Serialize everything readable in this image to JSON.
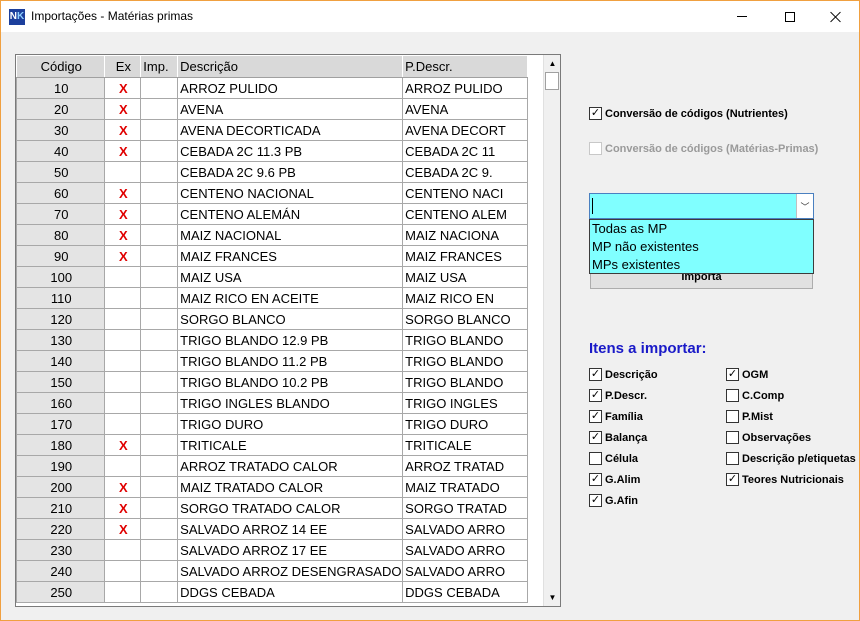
{
  "window": {
    "title": "Importações - Matérias primas",
    "icon_label": "NK"
  },
  "grid": {
    "headers": [
      "Código",
      "Ex",
      "Imp.",
      "Descrição",
      "P.Descr."
    ],
    "rows": [
      {
        "code": "10",
        "ex": "X",
        "imp": "",
        "desc": "ARROZ PULIDO",
        "pdesc": "ARROZ PULIDO"
      },
      {
        "code": "20",
        "ex": "X",
        "imp": "",
        "desc": "AVENA",
        "pdesc": "AVENA"
      },
      {
        "code": "30",
        "ex": "X",
        "imp": "",
        "desc": "AVENA DECORTICADA",
        "pdesc": "AVENA DECORT"
      },
      {
        "code": "40",
        "ex": "X",
        "imp": "",
        "desc": "CEBADA 2C 11.3 PB",
        "pdesc": "CEBADA 2C 11"
      },
      {
        "code": "50",
        "ex": "",
        "imp": "",
        "desc": "CEBADA 2C 9.6 PB",
        "pdesc": "CEBADA 2C 9."
      },
      {
        "code": "60",
        "ex": "X",
        "imp": "",
        "desc": "CENTENO NACIONAL",
        "pdesc": "CENTENO NACI"
      },
      {
        "code": "70",
        "ex": "X",
        "imp": "",
        "desc": "CENTENO ALEMÁN",
        "pdesc": "CENTENO ALEM"
      },
      {
        "code": "80",
        "ex": "X",
        "imp": "",
        "desc": "MAIZ NACIONAL",
        "pdesc": "MAIZ NACIONA"
      },
      {
        "code": "90",
        "ex": "X",
        "imp": "",
        "desc": "MAIZ FRANCES",
        "pdesc": "MAIZ FRANCES"
      },
      {
        "code": "100",
        "ex": "",
        "imp": "",
        "desc": "MAIZ USA",
        "pdesc": "MAIZ USA"
      },
      {
        "code": "110",
        "ex": "",
        "imp": "",
        "desc": "MAIZ RICO EN ACEITE",
        "pdesc": "MAIZ RICO EN"
      },
      {
        "code": "120",
        "ex": "",
        "imp": "",
        "desc": "SORGO BLANCO",
        "pdesc": "SORGO BLANCO"
      },
      {
        "code": "130",
        "ex": "",
        "imp": "",
        "desc": "TRIGO BLANDO 12.9 PB",
        "pdesc": "TRIGO BLANDO"
      },
      {
        "code": "140",
        "ex": "",
        "imp": "",
        "desc": "TRIGO BLANDO 11.2 PB",
        "pdesc": "TRIGO BLANDO"
      },
      {
        "code": "150",
        "ex": "",
        "imp": "",
        "desc": "TRIGO BLANDO 10.2 PB",
        "pdesc": "TRIGO BLANDO"
      },
      {
        "code": "160",
        "ex": "",
        "imp": "",
        "desc": "TRIGO INGLES BLANDO",
        "pdesc": "TRIGO INGLES"
      },
      {
        "code": "170",
        "ex": "",
        "imp": "",
        "desc": "TRIGO DURO",
        "pdesc": "TRIGO DURO"
      },
      {
        "code": "180",
        "ex": "X",
        "imp": "",
        "desc": "TRITICALE",
        "pdesc": "TRITICALE"
      },
      {
        "code": "190",
        "ex": "",
        "imp": "",
        "desc": "ARROZ TRATADO CALOR",
        "pdesc": "ARROZ TRATAD"
      },
      {
        "code": "200",
        "ex": "X",
        "imp": "",
        "desc": "MAIZ TRATADO CALOR",
        "pdesc": "MAIZ TRATADO"
      },
      {
        "code": "210",
        "ex": "X",
        "imp": "",
        "desc": "SORGO TRATADO CALOR",
        "pdesc": "SORGO TRATAD"
      },
      {
        "code": "220",
        "ex": "X",
        "imp": "",
        "desc": "SALVADO ARROZ 14 EE",
        "pdesc": "SALVADO ARRO"
      },
      {
        "code": "230",
        "ex": "",
        "imp": "",
        "desc": "SALVADO ARROZ 17 EE",
        "pdesc": "SALVADO ARRO"
      },
      {
        "code": "240",
        "ex": "",
        "imp": "",
        "desc": "SALVADO ARROZ DESENGRASADO",
        "pdesc": "SALVADO ARRO"
      },
      {
        "code": "250",
        "ex": "",
        "imp": "",
        "desc": "DDGS CEBADA",
        "pdesc": "DDGS CEBADA"
      }
    ]
  },
  "options": {
    "conv_nutrientes": {
      "label": "Conversão de códigos (Nutrientes)",
      "checked": true
    },
    "conv_mp": {
      "label": "Conversão de códigos (Matérias-Primas)",
      "checked": false,
      "disabled": true
    }
  },
  "filter": {
    "value": "",
    "options": [
      "Todas as MP",
      "MP não existentes",
      "MPs existentes"
    ]
  },
  "import_button": "Importa",
  "items_title": "Itens a importar:",
  "items_left": [
    {
      "label": "Descrição",
      "checked": true
    },
    {
      "label": "P.Descr.",
      "checked": true
    },
    {
      "label": "Família",
      "checked": true
    },
    {
      "label": "Balança",
      "checked": true
    },
    {
      "label": "Célula",
      "checked": false
    },
    {
      "label": "G.Alim",
      "checked": true
    },
    {
      "label": "G.Afin",
      "checked": true
    }
  ],
  "items_right": [
    {
      "label": "OGM",
      "checked": true
    },
    {
      "label": "C.Comp",
      "checked": false
    },
    {
      "label": "P.Mist",
      "checked": false
    },
    {
      "label": "Observações",
      "checked": false
    },
    {
      "label": "Descrição p/etiquetas",
      "checked": false
    },
    {
      "label": "Teores Nutricionais",
      "checked": true
    }
  ]
}
